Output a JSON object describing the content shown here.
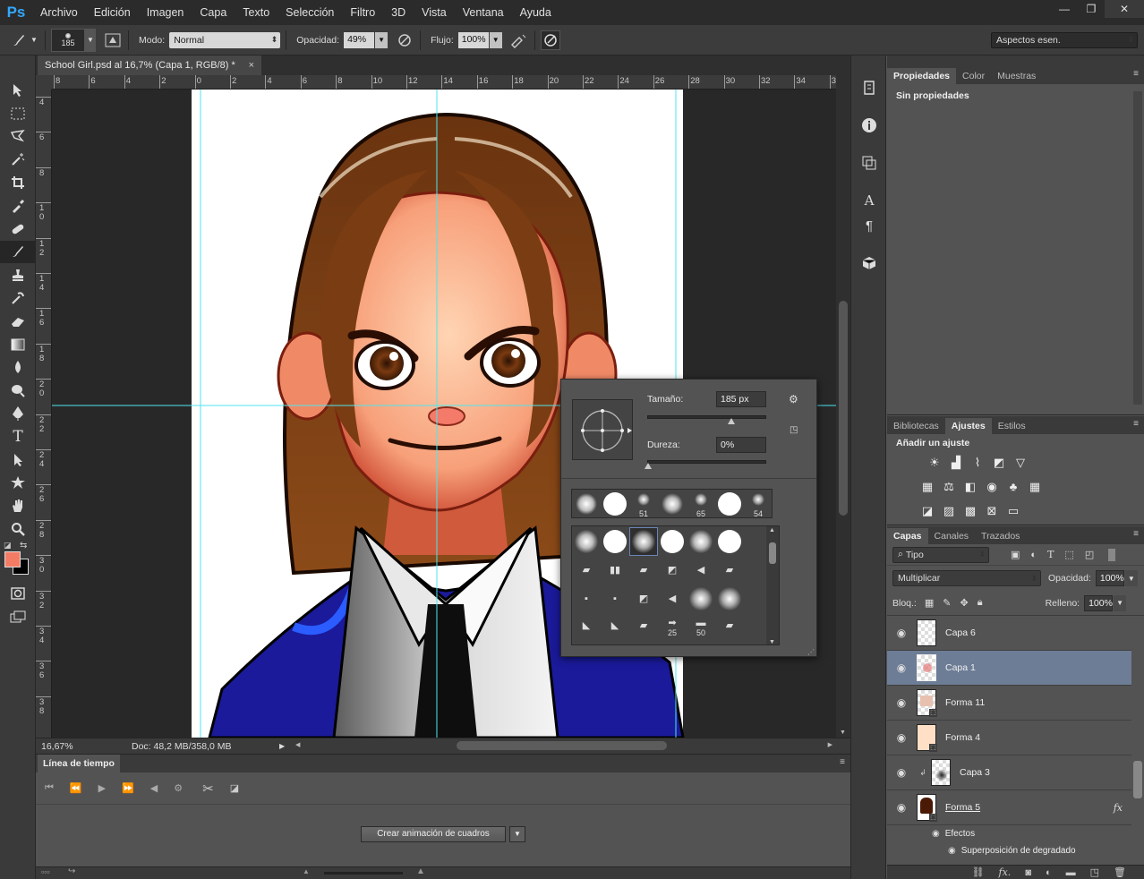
{
  "app": {
    "logo": "Ps"
  },
  "menu": [
    "Archivo",
    "Edición",
    "Imagen",
    "Capa",
    "Texto",
    "Selección",
    "Filtro",
    "3D",
    "Vista",
    "Ventana",
    "Ayuda"
  ],
  "window_controls": {
    "minimize": "—",
    "restore": "❐",
    "close": "✕"
  },
  "options": {
    "brush_size": "185",
    "mode_label": "Modo:",
    "mode_value": "Normal",
    "opacity_label": "Opacidad:",
    "opacity_value": "49%",
    "flow_label": "Flujo:",
    "flow_value": "100%",
    "workspace": "Aspectos esen."
  },
  "document": {
    "tab_title": "School Girl.psd al 16,7% (Capa 1, RGB/8) *",
    "zoom": "16,67%",
    "doc_info": "Doc: 48,2 MB/358,0 MB",
    "ruler_h": [
      "8",
      "6",
      "4",
      "2",
      "0",
      "2",
      "4",
      "6",
      "8",
      "10",
      "12",
      "14",
      "16",
      "18",
      "20",
      "22",
      "24",
      "26",
      "28",
      "30",
      "32",
      "34",
      "3"
    ],
    "ruler_v": [
      "4",
      "6",
      "8",
      "1\n0",
      "1\n2",
      "1\n4",
      "1\n6",
      "1\n8",
      "2\n0",
      "2\n2",
      "2\n4",
      "2\n6",
      "2\n8",
      "3\n0",
      "3\n2",
      "3\n4",
      "3\n6",
      "3\n8"
    ]
  },
  "brush_picker": {
    "size_label": "Tamaño:",
    "size_value": "185 px",
    "hardness_label": "Dureza:",
    "hardness_value": "0%",
    "recent_numbers": [
      "51",
      "65",
      "54"
    ],
    "grid_numbers": [
      "25",
      "50"
    ]
  },
  "timeline": {
    "title": "Línea de tiempo",
    "create_button": "Crear animación de cuadros"
  },
  "properties_panel": {
    "tabs": [
      "Propiedades",
      "Color",
      "Muestras"
    ],
    "content": "Sin propiedades"
  },
  "adjustments_panel": {
    "tabs": [
      "Bibliotecas",
      "Ajustes",
      "Estilos"
    ],
    "heading": "Añadir un ajuste"
  },
  "layers_panel": {
    "tabs": [
      "Capas",
      "Canales",
      "Trazados"
    ],
    "filter_kind": "Tipo",
    "blend_mode": "Multiplicar",
    "opacity_label": "Opacidad:",
    "opacity_value": "100%",
    "lock_label": "Bloq.:",
    "fill_label": "Relleno:",
    "fill_value": "100%",
    "layers": [
      {
        "name": "Capa 6"
      },
      {
        "name": "Capa 1"
      },
      {
        "name": "Forma 11"
      },
      {
        "name": "Forma 4"
      },
      {
        "name": "Capa 3"
      },
      {
        "name": "Forma 5"
      }
    ],
    "fx_label": "fx",
    "effects_label": "Efectos",
    "effect_name": "Superposición de degradado"
  }
}
